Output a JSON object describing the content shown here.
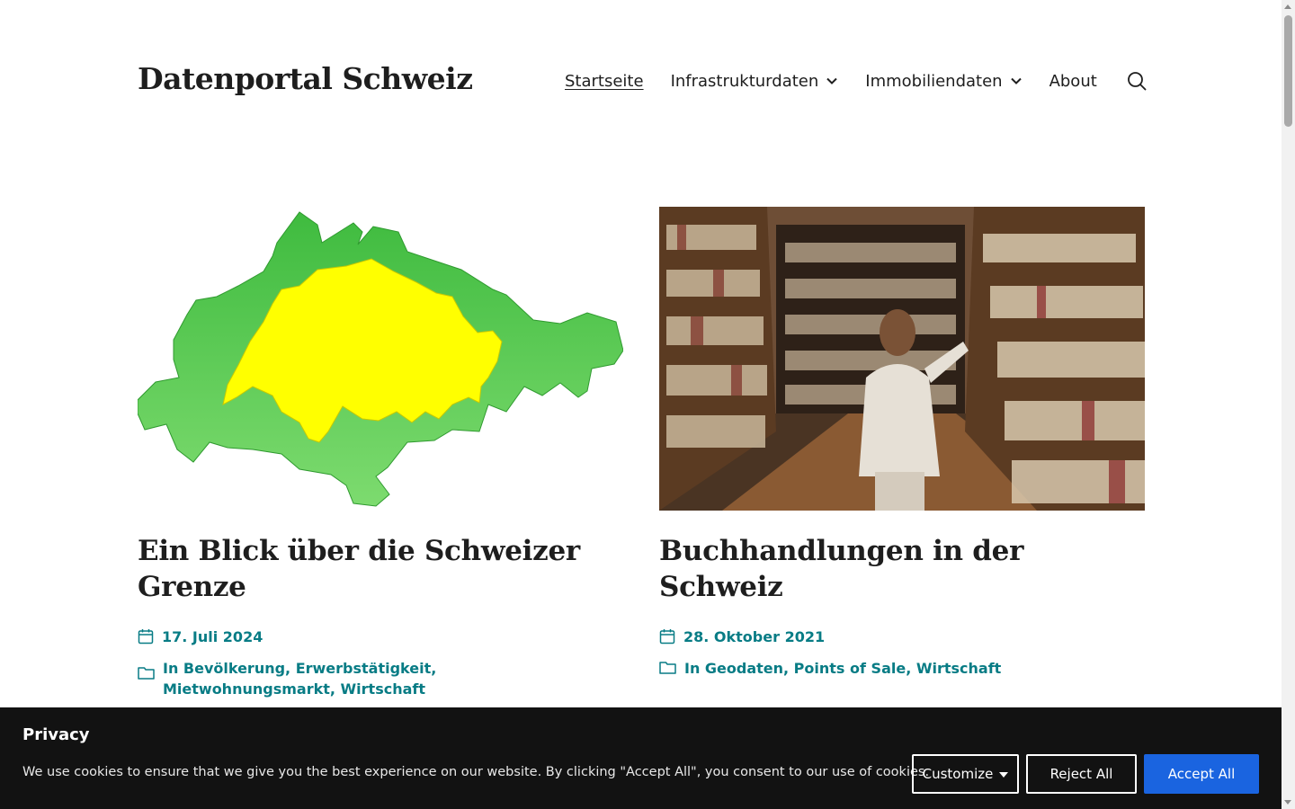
{
  "site": {
    "title": "Datenportal Schweiz"
  },
  "nav": {
    "items": [
      {
        "label": "Startseite",
        "current": true,
        "has_submenu": false
      },
      {
        "label": "Infrastrukturdaten",
        "current": false,
        "has_submenu": true
      },
      {
        "label": "Immobiliendaten",
        "current": false,
        "has_submenu": true
      },
      {
        "label": "About",
        "current": false,
        "has_submenu": false
      }
    ],
    "search_icon": "search-icon"
  },
  "posts": [
    {
      "title": "Ein Blick über die Schweizer Grenze",
      "date": "17. Juli 2024",
      "categories": "In Bevölkerung, Erwerbstätigkeit, Mietwohnungsmarkt, Wirtschaft",
      "image": "map of Switzerland (yellow) with neighbouring regions (green)"
    },
    {
      "title": "Buchhandlungen in der Schweiz",
      "date": "28. Oktober 2021",
      "categories": "In Geodaten, Points of Sale, Wirtschaft",
      "image": "woman browsing books in a bookstore"
    }
  ],
  "cookie_banner": {
    "title": "Privacy",
    "text": "We use cookies to ensure that we give you the best experience on our website. By clicking \"Accept All\", you consent to our use of cookies.",
    "customize_label": "Customize",
    "reject_label": "Reject All",
    "accept_label": "Accept All"
  },
  "colors": {
    "link": "#087c85",
    "accept_button": "#1a64e0",
    "banner_bg": "#121212",
    "map_switzerland": "#ffff00",
    "map_neighbors": "#4cc24c"
  }
}
